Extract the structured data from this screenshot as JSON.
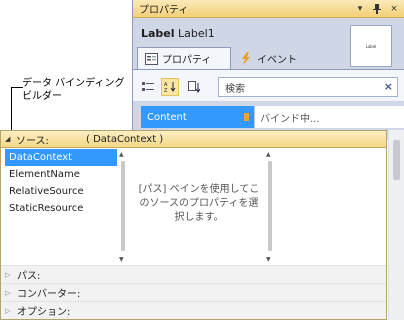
{
  "callout": {
    "text": "データ バインディング ビルダー"
  },
  "properties_window": {
    "title": "プロパティ",
    "title_buttons": {
      "dropdown": "▾",
      "pin": "ᵖ",
      "close": "×"
    },
    "object_type": "Label",
    "object_name": "Label1",
    "preview_text": "Label",
    "tabs": [
      {
        "label": "プロパティ",
        "icon": "properties-icon"
      },
      {
        "label": "イベント",
        "icon": "lightning-icon"
      }
    ],
    "search": {
      "placeholder": "検索",
      "clear": "×"
    },
    "property": {
      "name": "Content",
      "value": "バインド中..."
    }
  },
  "builder": {
    "source_label": "ソース:",
    "source_value": "( DataContext )",
    "sources": [
      "DataContext",
      "ElementName",
      "RelativeSource",
      "StaticResource"
    ],
    "selected_source": "DataContext",
    "hint": "[パス] ペインを使用してこのソースのプロパティを選択します。",
    "groups": [
      "パス:",
      "コンバーター:",
      "オプション:"
    ]
  },
  "colors": {
    "selection": "#3399ff",
    "header": "#f5d886",
    "panel": "#cfd6e5"
  }
}
